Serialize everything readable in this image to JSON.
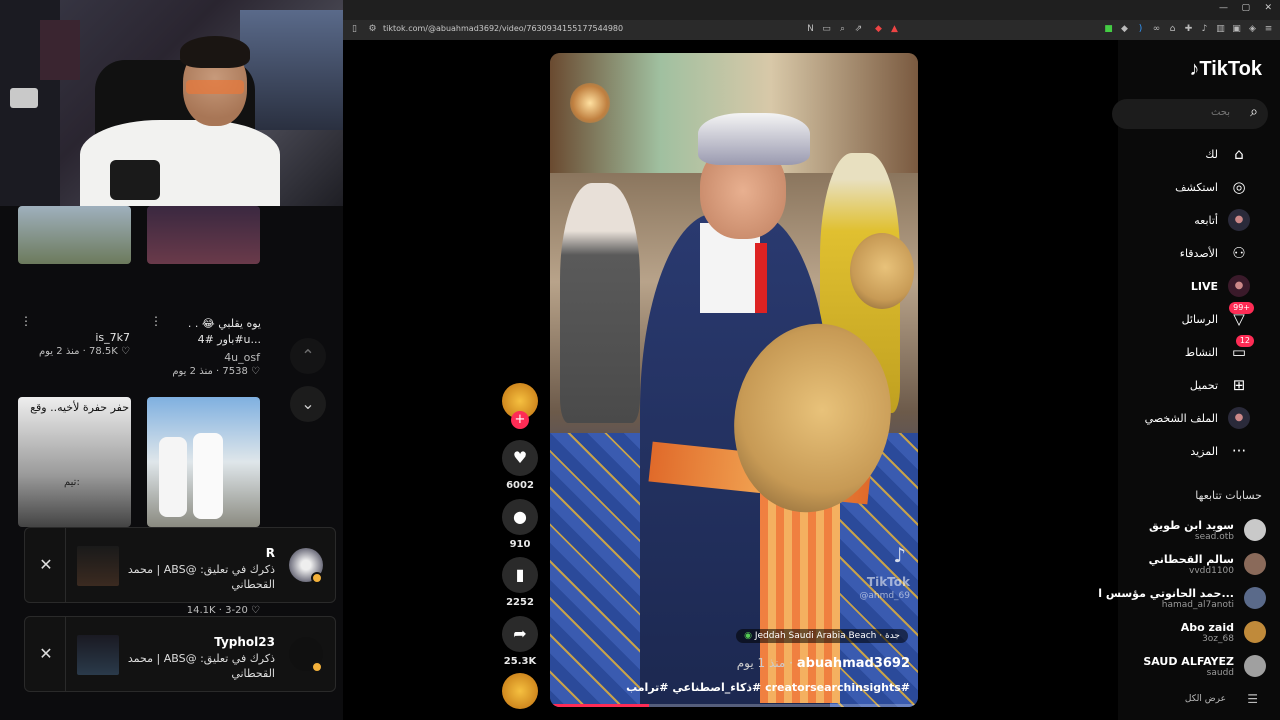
{
  "browser": {
    "url": "tiktok.com/@abuahmad3692/video/7630934155177544980",
    "window_controls": [
      "—",
      "▢",
      "✕"
    ]
  },
  "left_panel": {
    "grid": [
      {
        "title": "is_7k7",
        "author": "",
        "likes": "78.5K",
        "age": "منذ 2 يوم"
      },
      {
        "title": "يوه يقلبي 😂 . . #باور #4u...",
        "author": "4u_osf",
        "likes": "7538",
        "age": "منذ 2 يوم"
      }
    ],
    "thumb_caption": "حفر حفرة لأخيه.. وقع",
    "thumb_caption2": "تيم:",
    "bottom_row": {
      "date": "3-20",
      "likes": "14.1K"
    },
    "notifications": [
      {
        "name": "R",
        "body": "ذكرك في تعليق: @ABS | محمد القحطاني"
      },
      {
        "name": "Typhol23",
        "body": "ذكرك في تعليق: @ABS | محمد القحطاني"
      }
    ],
    "nav_up": "⌃",
    "nav_down": "⌄"
  },
  "video": {
    "author": "abuahmad3692",
    "age": "منذ 1 يوم",
    "location": "Jeddah Saudi Arabia Beach · جدة",
    "caption": "#creatorsearchinsights #ذكاء_اصطناعي #ترامب",
    "watermark": "TikTok",
    "watermark_handle": "@ahmd_69",
    "progress": 0.27
  },
  "actions": {
    "likes": "6002",
    "comments": "910",
    "saves": "2252",
    "shares": "25.3K"
  },
  "sidebar": {
    "logo": "TikTok",
    "search_placeholder": "بحث",
    "items": [
      {
        "label": "لك",
        "icon": "home-icon"
      },
      {
        "label": "استكشف",
        "icon": "compass-icon"
      },
      {
        "label": "أتابعه",
        "icon": "following-icon"
      },
      {
        "label": "الأصدقاء",
        "icon": "friends-icon"
      },
      {
        "label": "LIVE",
        "icon": "live-icon"
      },
      {
        "label": "الرسائل",
        "icon": "messages-icon",
        "badge": "99+"
      },
      {
        "label": "النشاط",
        "icon": "activity-icon",
        "badge": "12"
      },
      {
        "label": "تحميل",
        "icon": "upload-icon"
      },
      {
        "label": "الملف الشخصي",
        "icon": "profile-icon"
      },
      {
        "label": "المزيد",
        "icon": "more-icon"
      }
    ],
    "following_header": "حسابات تتابعها",
    "following": [
      {
        "name": "سويد ابن طويق",
        "handle": "sead.otb"
      },
      {
        "name": "سالم القحطاني",
        "handle": "vvdd1100"
      },
      {
        "name": "حمد الحانوتي مؤسس ا...",
        "handle": "hamad_al7anoti"
      },
      {
        "name": "Abo zaid",
        "handle": "3oz_68"
      },
      {
        "name": "SAUD ALFAYEZ",
        "handle": "saudd"
      }
    ],
    "show_all": "عرض الكل"
  },
  "colors": {
    "accent": "#fe2c55",
    "bg": "#000000"
  }
}
